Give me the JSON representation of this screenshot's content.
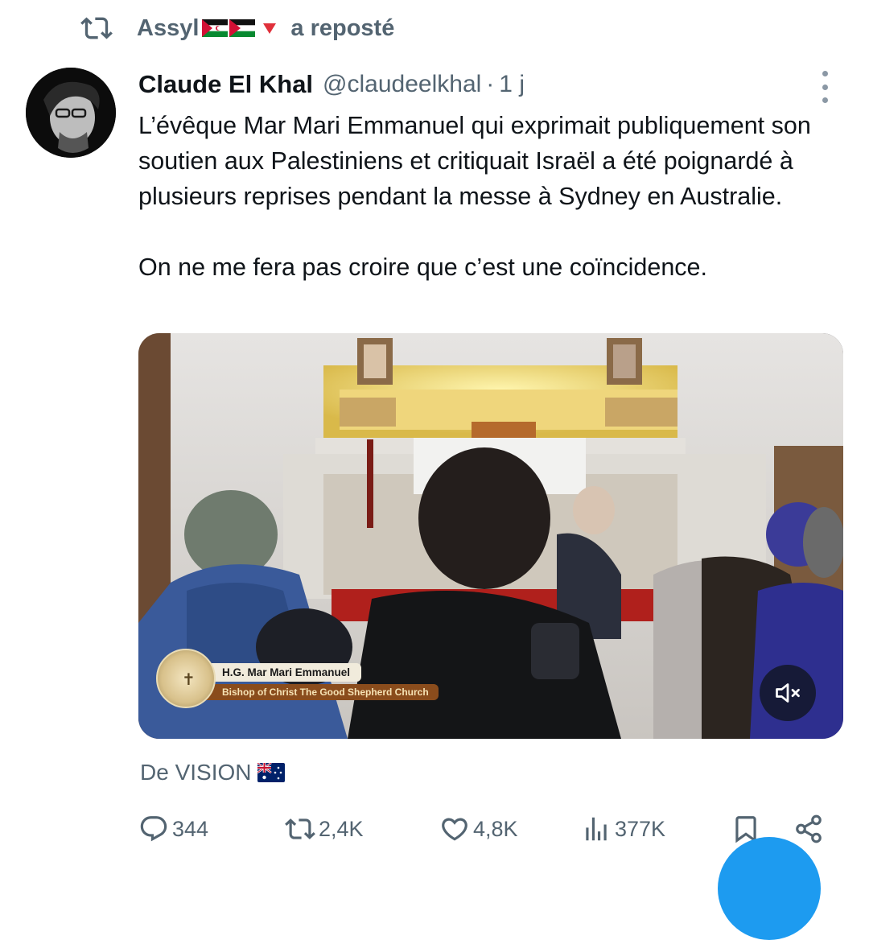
{
  "repost": {
    "user": "Assyl",
    "action": "a reposté"
  },
  "tweet": {
    "display_name": "Claude El Khal",
    "handle": "@claudeelkhal",
    "separator": "·",
    "time": "1 j",
    "paragraphs": [
      "L’évêque Mar Mari Emmanuel qui exprimait publiquement son soutien aux Palestiniens et critiquait Israël a été poignardé à plusieurs reprises pendant la messe à Sydney en Australie.",
      "On ne me fera pas croire que c’est une coïncidence."
    ],
    "media": {
      "lower_third_name": "H.G. Mar Mari Emmanuel",
      "lower_third_title": "Bishop of Christ The Good Shepherd Church",
      "mute_icon": "speaker-muted-icon"
    },
    "source_label": "De VISION",
    "source_flag": "australia-flag"
  },
  "actions": {
    "replies": "344",
    "reposts": "2,4K",
    "likes": "4,8K",
    "views": "377K"
  },
  "colors": {
    "text": "#0f1419",
    "secondary": "#536471",
    "accent": "#1d9bf0"
  }
}
